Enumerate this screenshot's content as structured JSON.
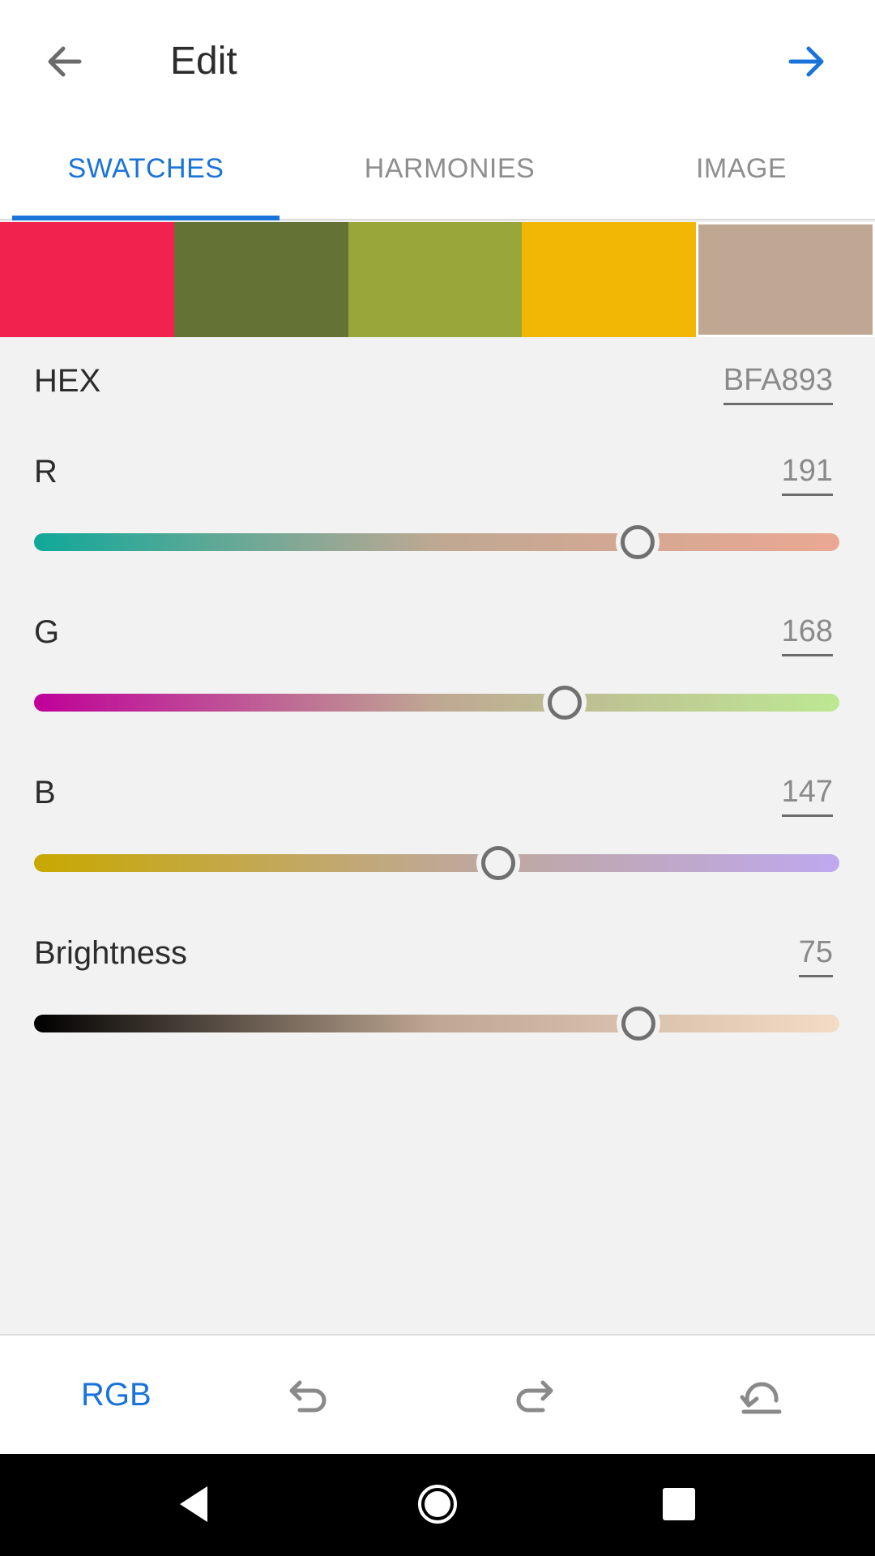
{
  "appbar": {
    "title": "Edit",
    "back_icon": "arrow-left-icon",
    "next_icon": "arrow-right-icon"
  },
  "tabs": [
    {
      "label": "SWATCHES",
      "active": true
    },
    {
      "label": "HARMONIES",
      "active": false
    },
    {
      "label": "IMAGE",
      "active": false
    }
  ],
  "swatches": [
    {
      "color": "#F2224E"
    },
    {
      "color": "#647236"
    },
    {
      "color": "#98A63A"
    },
    {
      "color": "#F2B705"
    },
    {
      "color": "#BFA893",
      "selected": true
    }
  ],
  "hex": {
    "label": "HEX",
    "value": "BFA893"
  },
  "sliders": {
    "r": {
      "label": "R",
      "value": "191",
      "max": 255,
      "gradient": [
        "#0fa899",
        "#bfa893",
        "#eaa893"
      ]
    },
    "g": {
      "label": "G",
      "value": "168",
      "max": 255,
      "gradient": [
        "#bf0099",
        "#bfa893",
        "#bde893"
      ]
    },
    "b": {
      "label": "B",
      "value": "147",
      "max": 255,
      "gradient": [
        "#c8a800",
        "#bfa893",
        "#bfa8ef"
      ]
    },
    "brightness": {
      "label": "Brightness",
      "value": "75",
      "max": 100,
      "gradient": [
        "#000000",
        "#bfa893",
        "#f2dcc6"
      ]
    }
  },
  "bottombar": {
    "mode_label": "RGB",
    "undo_icon": "undo-icon",
    "redo_icon": "redo-icon",
    "reset_icon": "reset-icon"
  },
  "navbar": {
    "back_icon": "nav-back-icon",
    "home_icon": "nav-home-icon",
    "recents_icon": "nav-recents-icon"
  },
  "colors": {
    "accent": "#1a73d8",
    "background": "#f2f2f2"
  }
}
